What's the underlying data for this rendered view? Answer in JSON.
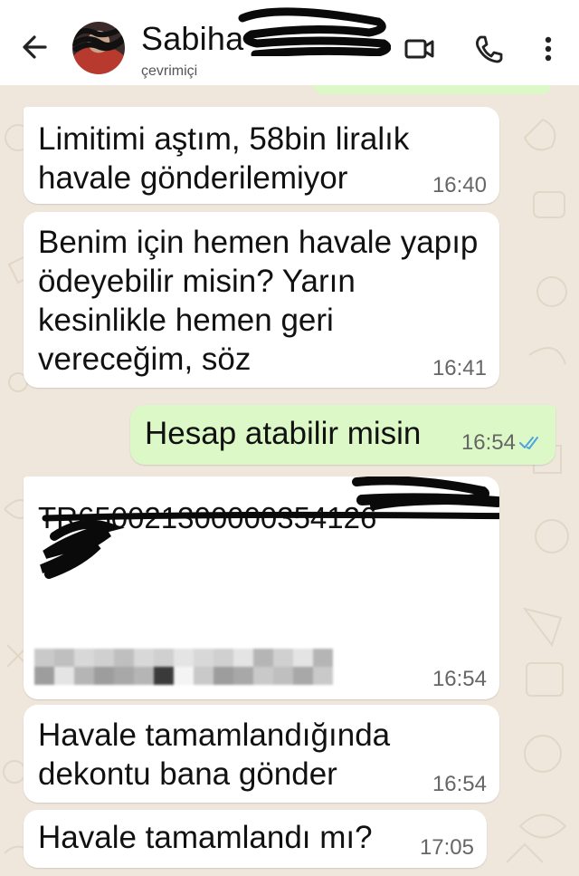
{
  "header": {
    "contact_name": "Sabiha",
    "status": "çevrimiçi",
    "icons": [
      "back-arrow-icon",
      "video-call-icon",
      "voice-call-icon",
      "more-options-icon"
    ]
  },
  "messages": [
    {
      "direction": "incoming",
      "text": "Limitimi aştım, 58bin liralık havale gönderilemiyor",
      "time": "16:40"
    },
    {
      "direction": "incoming",
      "text": "Benim için hemen havale yapıp ödeyebilir misin? Yarın kesinlikle hemen geri vereceğim, söz",
      "time": "16:41"
    },
    {
      "direction": "outgoing",
      "text": "Hesap atabilir misin",
      "time": "16:54",
      "status": "read"
    },
    {
      "direction": "incoming",
      "text": "TR650021300000354126",
      "time": "16:54",
      "redacted": true
    },
    {
      "direction": "incoming",
      "text": "Havale tamamlandığında dekontu bana gönder",
      "time": "16:54"
    },
    {
      "direction": "incoming",
      "text": "Havale tamamlandı mı?",
      "time": "17:05"
    }
  ],
  "colors": {
    "chat_background": "#efe7dc",
    "incoming_bubble": "#ffffff",
    "outgoing_bubble": "#dcf8c6",
    "read_ticks": "#4fa3e0"
  }
}
